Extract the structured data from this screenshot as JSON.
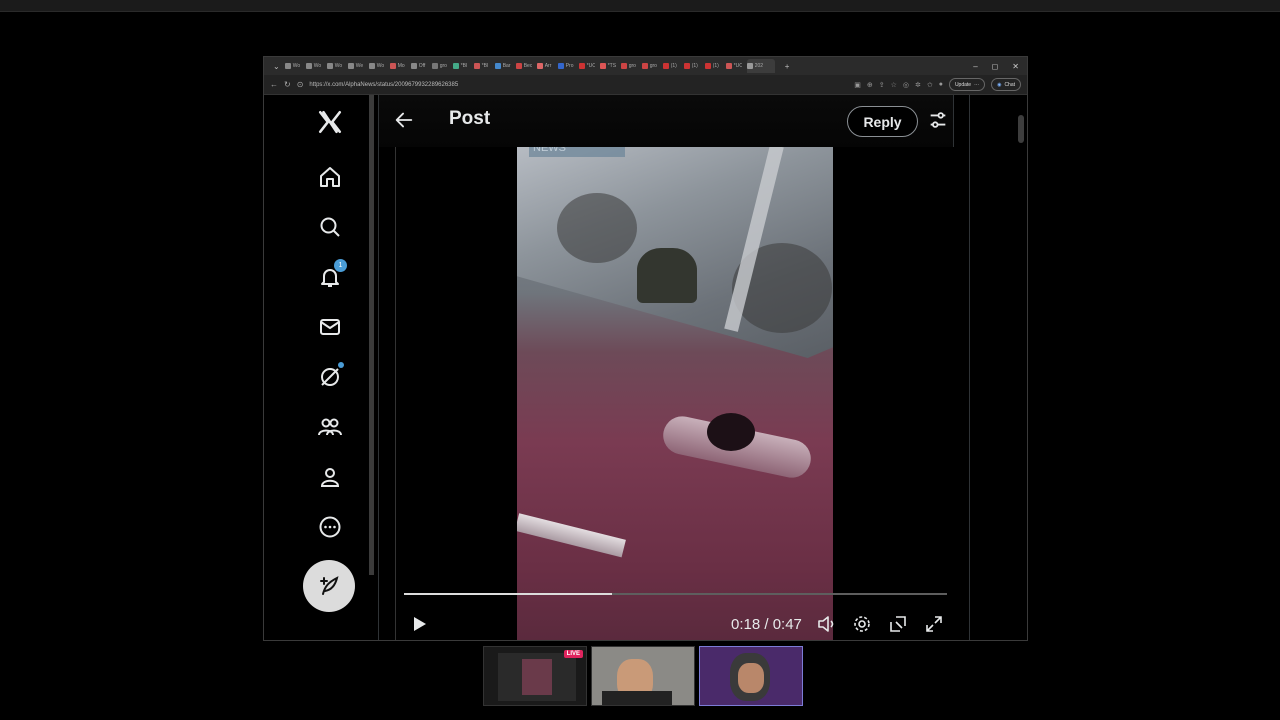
{
  "browser": {
    "tab_labels": [
      "Wo",
      "Wo",
      "Wo",
      "We",
      "Wo",
      "Mo",
      "Off",
      "gro",
      "*Bl",
      "*Bl",
      "Bar",
      "Bec",
      "Arr",
      "Pro",
      "*UC",
      "*TS",
      "gro",
      "gro",
      "(1)",
      "(1)",
      "(1)",
      "*UC",
      "202"
    ],
    "active_tab_label": "202",
    "new_tab_symbol": "+",
    "url": "https://x.com/AlphaNews/status/2009679932289626385",
    "update_label": "Update",
    "chat_label": "Chat",
    "window_controls": [
      "–",
      "◻",
      "✕"
    ]
  },
  "header": {
    "title": "Post",
    "reply_label": "Reply"
  },
  "sidebar": {
    "notifications_badge": "1",
    "items": [
      "home-icon",
      "search-icon",
      "notifications-icon",
      "messages-icon",
      "grok-icon",
      "communities-icon",
      "profile-icon",
      "more-icon"
    ]
  },
  "video": {
    "overlay_tag": "NEWS",
    "current_time": "0:18",
    "duration": "0:47",
    "time_display": "0:18 / 0:47",
    "progress_fraction": 0.383
  },
  "stream": {
    "live_label": "LIVE"
  },
  "colors": {
    "accent": "#4a9cd6",
    "live": "#e0245e",
    "background": "#000000"
  }
}
